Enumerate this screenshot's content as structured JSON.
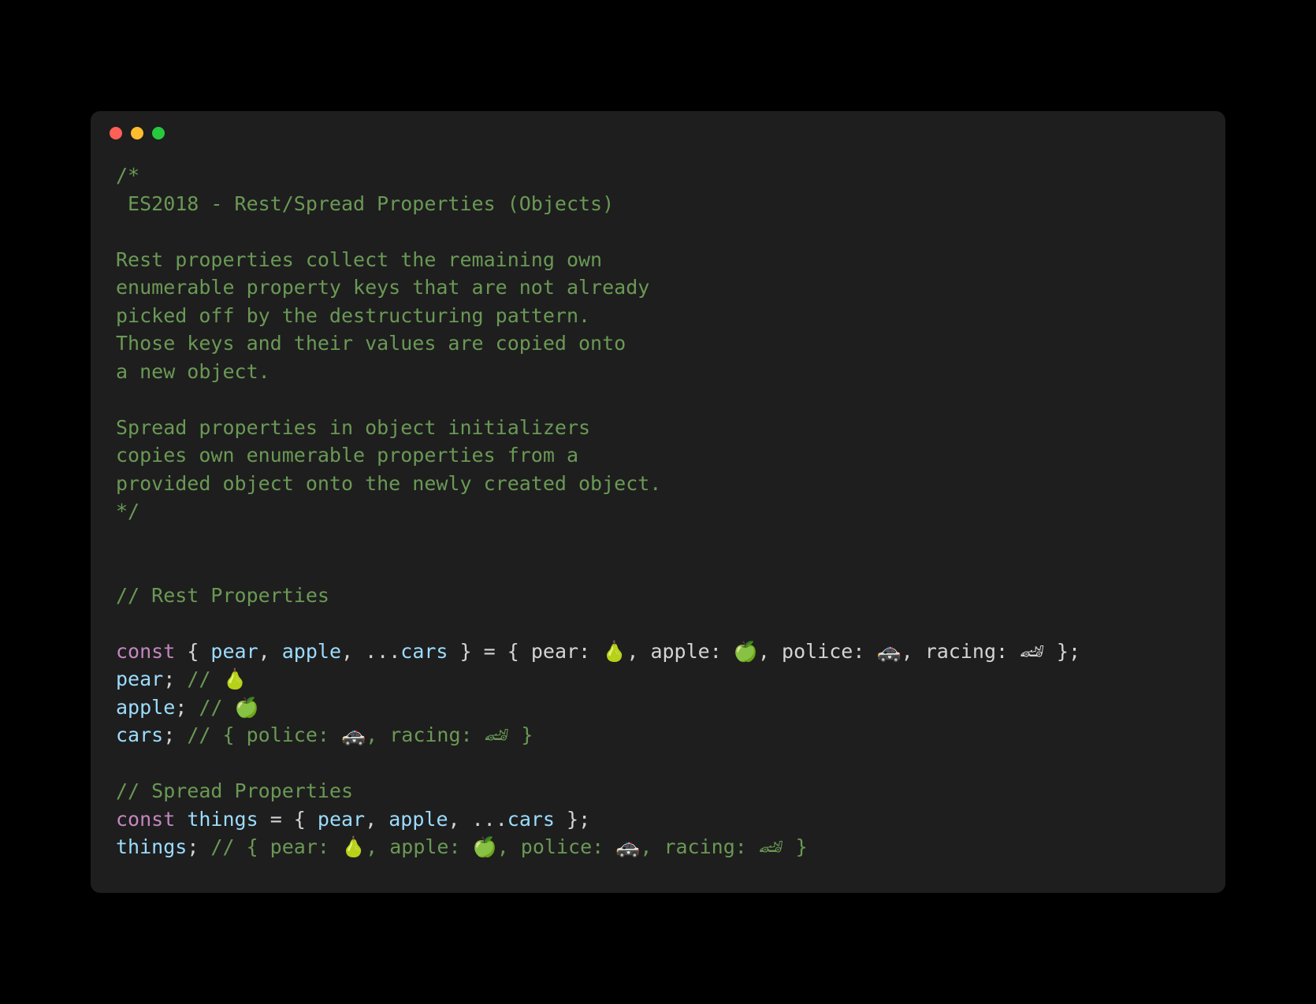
{
  "titlebar": {
    "close": "red",
    "minimize": "yellow",
    "maximize": "green"
  },
  "code": {
    "blockComment": "/*\n ES2018 - Rest/Spread Properties (Objects)\n\nRest properties collect the remaining own \nenumerable property keys that are not already \npicked off by the destructuring pattern. \nThose keys and their values are copied onto \na new object.\n\nSpread properties in object initializers \ncopies own enumerable properties from a \nprovided object onto the newly created object.\n*/",
    "restHeader": "// Rest Properties",
    "line1": {
      "const": "const",
      "destructOpen": " { ",
      "pear": "pear",
      "sep1": ", ",
      "apple": "apple",
      "sep2": ", ...",
      "cars": "cars",
      "destructClose": " } ",
      "assign": "=",
      "objOpen": " { ",
      "pearKey": "pear",
      "pearVal": ": 🍐, ",
      "appleKey": "apple",
      "appleVal": ": 🍏, ",
      "policeKey": "police",
      "policeVal": ": 🚓, ",
      "racingKey": "racing",
      "racingVal": ": 🏎 ",
      "objClose": "};"
    },
    "line2": {
      "var": "pear",
      "semi": ";",
      "comment": " // 🍐"
    },
    "line3": {
      "var": "apple",
      "semi": ";",
      "comment": " // 🍏"
    },
    "line4": {
      "var": "cars",
      "semi": ";",
      "comment": " // { police: 🚓, racing: 🏎 }"
    },
    "spreadHeader": "// Spread Properties",
    "line5": {
      "const": "const",
      "sp": " ",
      "things": "things",
      "assign": " = ",
      "objOpen": "{ ",
      "pear": "pear",
      "sep1": ", ",
      "apple": "apple",
      "sep2": ", ...",
      "cars": "cars",
      "objClose": " };"
    },
    "line6": {
      "var": "things",
      "semi": ";",
      "comment": " // { pear: 🍐, apple: 🍏, police: 🚓, racing: 🏎 }"
    }
  }
}
